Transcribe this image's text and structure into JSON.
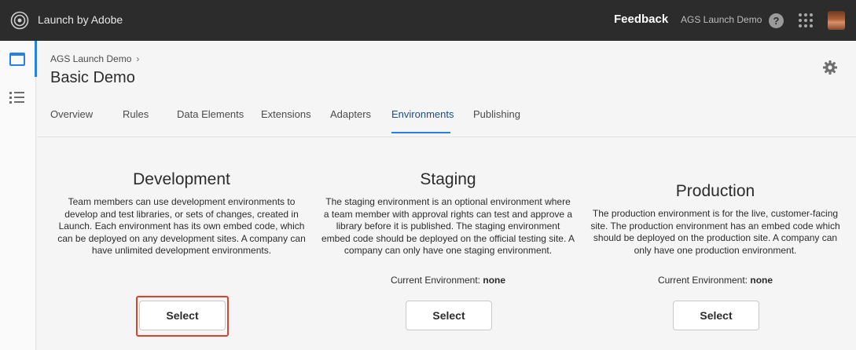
{
  "topbar": {
    "app_title": "Launch by Adobe",
    "logo_icon": "adobe-launch-logo-icon",
    "feedback_label": "Feedback",
    "org_name": "AGS Launch Demo",
    "help_label": "?",
    "help_icon": "help-icon",
    "apps_icon": "app-switcher-icon",
    "avatar_icon": "user-avatar"
  },
  "rail": {
    "items": [
      {
        "icon": "window-icon",
        "active": true
      },
      {
        "icon": "list-icon",
        "active": false
      }
    ]
  },
  "header": {
    "breadcrumb": "AGS Launch Demo",
    "title": "Basic Demo",
    "settings_icon": "gear-icon"
  },
  "tabs": [
    {
      "label": "Overview"
    },
    {
      "label": "Rules"
    },
    {
      "label": "Data Elements"
    },
    {
      "label": "Extensions"
    },
    {
      "label": "Adapters"
    },
    {
      "label": "Environments",
      "active": true
    },
    {
      "label": "Publishing"
    }
  ],
  "environments": [
    {
      "title": "Development",
      "description": [
        "Team members can use development environments to",
        "develop and test libraries, or sets of changes, created in",
        "Launch. Each environment has its own embed code, which",
        "can be deployed on any development sites. A company can",
        "have unlimited development environments."
      ],
      "current_label": "",
      "current_value": "",
      "select_label": "Select"
    },
    {
      "title": "Staging",
      "description": [
        "The staging environment is an optional environment where",
        "a team member with approval rights can test and approve a",
        "library before it is published. The staging environment",
        "embed code should be deployed on the official testing site. A",
        "company can only have one staging environment."
      ],
      "current_label": "Current Environment:",
      "current_value": "none",
      "select_label": "Select"
    },
    {
      "title": "Production",
      "description": [
        "The production environment is for the live, customer-facing",
        "site. The production environment has an embed code which",
        "should be deployed on the production site. A company can",
        "only have one production environment."
      ],
      "current_label": "Current Environment:",
      "current_value": "none",
      "select_label": "Select"
    }
  ],
  "colors": {
    "topbar": "#2c2c2c",
    "accent": "#2680eb",
    "highlight": "#e0412b"
  }
}
